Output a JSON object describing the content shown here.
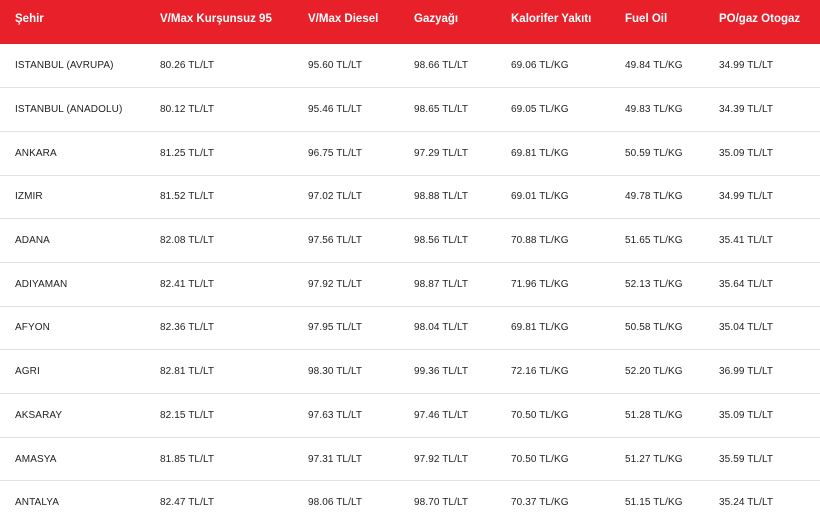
{
  "table": {
    "headers": [
      "Şehir",
      "V/Max Kurşunsuz 95",
      "V/Max Diesel",
      "Gazyağı",
      "Kalorifer Yakıtı",
      "Fuel Oil",
      "PO/gaz Otogaz"
    ],
    "rows": [
      [
        "ISTANBUL (AVRUPA)",
        "80.26 TL/LT",
        "95.60 TL/LT",
        "98.66 TL/LT",
        "69.06 TL/KG",
        "49.84 TL/KG",
        "34.99 TL/LT"
      ],
      [
        "ISTANBUL (ANADOLU)",
        "80.12 TL/LT",
        "95.46 TL/LT",
        "98.65 TL/LT",
        "69.05 TL/KG",
        "49.83 TL/KG",
        "34.39 TL/LT"
      ],
      [
        "ANKARA",
        "81.25 TL/LT",
        "96.75 TL/LT",
        "97.29 TL/LT",
        "69.81 TL/KG",
        "50.59 TL/KG",
        "35.09 TL/LT"
      ],
      [
        "IZMIR",
        "81.52 TL/LT",
        "97.02 TL/LT",
        "98.88 TL/LT",
        "69.01 TL/KG",
        "49.78 TL/KG",
        "34.99 TL/LT"
      ],
      [
        "ADANA",
        "82.08 TL/LT",
        "97.56 TL/LT",
        "98.56 TL/LT",
        "70.88 TL/KG",
        "51.65 TL/KG",
        "35.41 TL/LT"
      ],
      [
        "ADIYAMAN",
        "82.41 TL/LT",
        "97.92 TL/LT",
        "98.87 TL/LT",
        "71.96 TL/KG",
        "52.13 TL/KG",
        "35.64 TL/LT"
      ],
      [
        "AFYON",
        "82.36 TL/LT",
        "97.95 TL/LT",
        "98.04 TL/LT",
        "69.81 TL/KG",
        "50.58 TL/KG",
        "35.04 TL/LT"
      ],
      [
        "AGRI",
        "82.81 TL/LT",
        "98.30 TL/LT",
        "99.36 TL/LT",
        "72.16 TL/KG",
        "52.20 TL/KG",
        "36.99 TL/LT"
      ],
      [
        "AKSARAY",
        "82.15 TL/LT",
        "97.63 TL/LT",
        "97.46 TL/LT",
        "70.50 TL/KG",
        "51.28 TL/KG",
        "35.09 TL/LT"
      ],
      [
        "AMASYA",
        "81.85 TL/LT",
        "97.31 TL/LT",
        "97.92 TL/LT",
        "70.50 TL/KG",
        "51.27 TL/KG",
        "35.59 TL/LT"
      ],
      [
        "ANTALYA",
        "82.47 TL/LT",
        "98.06 TL/LT",
        "98.70 TL/LT",
        "70.37 TL/KG",
        "51.15 TL/KG",
        "35.24 TL/LT"
      ]
    ]
  },
  "colors": {
    "header_bg": "#e8202a",
    "header_text": "#ffffff",
    "row_divider": "#e2e2e2",
    "cell_text": "#222222"
  }
}
